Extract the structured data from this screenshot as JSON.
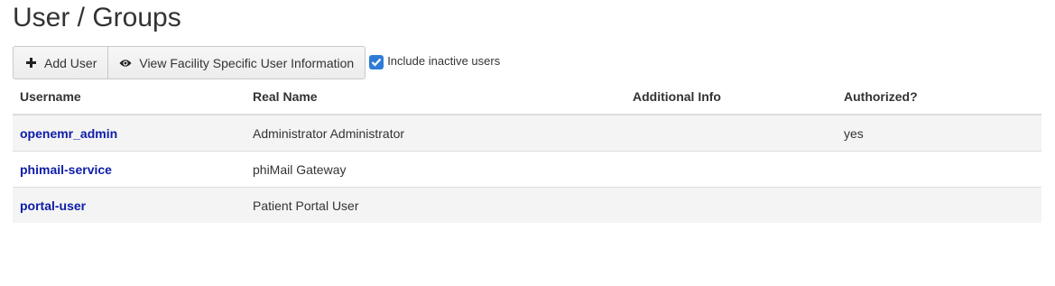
{
  "page": {
    "title": "User / Groups"
  },
  "toolbar": {
    "add_user_label": "Add User",
    "view_facility_label": "View Facility Specific User Information",
    "include_inactive_label": "Include inactive users",
    "include_inactive_checked": true
  },
  "table": {
    "headers": [
      "Username",
      "Real Name",
      "Additional Info",
      "Authorized?"
    ],
    "rows": [
      {
        "username": "openemr_admin",
        "real_name": "Administrator Administrator",
        "additional_info": "",
        "authorized": "yes"
      },
      {
        "username": "phimail-service",
        "real_name": "phiMail Gateway",
        "additional_info": "",
        "authorized": ""
      },
      {
        "username": "portal-user",
        "real_name": "Patient Portal User",
        "additional_info": "",
        "authorized": ""
      }
    ]
  },
  "colors": {
    "link": "#0d1ca8",
    "checkbox": "#2f7cd6",
    "row_stripe": "#f4f4f4"
  },
  "icons": {
    "add_user": "plus-icon",
    "view_facility": "eye-icon",
    "checkbox": "check-icon"
  }
}
